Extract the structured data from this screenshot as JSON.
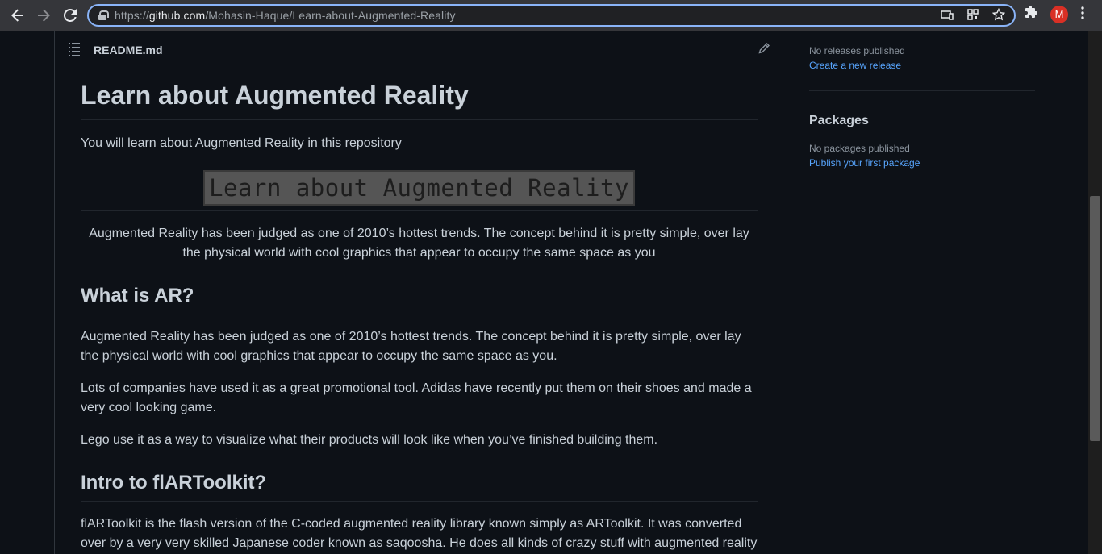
{
  "browser": {
    "url_prefix": "https://",
    "url_host": "github.com",
    "url_path": "/Mohasin-Haque/Learn-about-Augmented-Reality",
    "avatar_letter": "M"
  },
  "readme": {
    "filename": "README.md",
    "title": "Learn about Augmented Reality",
    "intro": "You will learn about Augmented Reality in this repository",
    "banner_text": "Learn about Augmented Reality",
    "center_text": "Augmented Reality has been judged as one of 2010’s hottest trends. The concept behind it is pretty simple, over lay the physical world with cool graphics that appear to occupy the same space as you",
    "section1_heading": "What is AR?",
    "section1_p1": "Augmented Reality has been judged as one of 2010’s hottest trends. The concept behind it is pretty simple, over lay the physical world with cool graphics that appear to occupy the same space as you.",
    "section1_p2": "Lots of companies have used it as a great promotional tool. Adidas have recently put them on their shoes and made a very cool looking game.",
    "section1_p3": "Lego use it as a way to visualize what their products will look like when you’ve finished building them.",
    "section2_heading": "Intro to flARToolkit?",
    "section2_p1": "flARToolkit is the flash version of the C-coded augmented reality library known simply as ARToolkit. It was converted over by a very very skilled Japanese coder known as saqoosha. He does all kinds of crazy stuff with augmented reality"
  },
  "sidebar": {
    "releases_status": "No releases published",
    "releases_link": "Create a new release",
    "packages_heading": "Packages",
    "packages_status": "No packages published",
    "packages_link": "Publish your first package"
  }
}
